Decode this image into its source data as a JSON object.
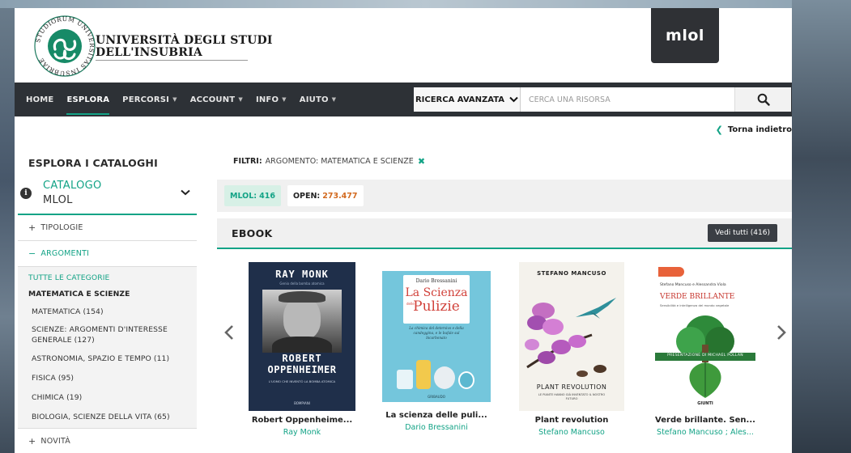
{
  "university": {
    "name_line1": "UNIVERSITÀ DEGLI STUDI",
    "name_line2": "DELL'INSUBRIA",
    "seal_text": "STUDIORUM UNIVERSITAS INSUBRIAE"
  },
  "brand": {
    "logo": "mlol"
  },
  "nav": {
    "items": [
      {
        "label": "HOME",
        "active": false,
        "dropdown": false
      },
      {
        "label": "ESPLORA",
        "active": true,
        "dropdown": false
      },
      {
        "label": "PERCORSI",
        "active": false,
        "dropdown": true
      },
      {
        "label": "ACCOUNT",
        "active": false,
        "dropdown": true
      },
      {
        "label": "INFO",
        "active": false,
        "dropdown": true
      },
      {
        "label": "AIUTO",
        "active": false,
        "dropdown": true
      }
    ]
  },
  "search": {
    "mode_label": "RICERCA AVANZATA",
    "placeholder": "CERCA UNA RISORSA",
    "icon": "search-icon"
  },
  "back_link": "Torna indietro",
  "sidebar": {
    "title": "ESPLORA I CATALOGHI",
    "catalog_label": "CATALOGO",
    "catalog_value": "MLOL",
    "sections": {
      "tipologie": "TIPOLOGIE",
      "argomenti": "ARGOMENTI",
      "novita": "NOVITÀ"
    },
    "categories": {
      "all": "TUTTE LE CATEGORIE",
      "current": "MATEMATICA E SCIENZE",
      "items": [
        "MATEMATICA (154)",
        "SCIENZE: ARGOMENTI D'INTERESSE GENERALE (127)",
        "ASTRONOMIA, SPAZIO E TEMPO (11)",
        "FISICA (95)",
        "CHIMICA (19)",
        "BIOLOGIA, SCIENZE DELLA VITA (65)"
      ]
    }
  },
  "filters": {
    "label": "FILTRI:",
    "value": "ARGOMENTO: MATEMATICA E SCIENZE"
  },
  "tabs": {
    "mlol_label": "MLOL:",
    "mlol_count": "416",
    "open_label": "OPEN:",
    "open_count": "273.477"
  },
  "ebook": {
    "title": "EBOOK",
    "see_all": "Vedi tutti (416)"
  },
  "books": [
    {
      "title": "Robert Oppenheime...",
      "author": "Ray Monk",
      "cover_author": "RAY MONK",
      "cover_sub": "Genio della bomba atomica",
      "cover_title_1": "ROBERT",
      "cover_title_2": "OPPENHEIMER",
      "cover_tag": "L'UOMO CHE INVENTÒ LA BOMBA ATOMICA",
      "cover_publisher": "BOMPIANI"
    },
    {
      "title": "La scienza delle puli...",
      "author": "Dario Bressanini",
      "cover_author": "Dario Bressanini",
      "cover_title_1": "La Scienza",
      "cover_title_small": "delle",
      "cover_title_2": "Pulizie",
      "cover_sub": "La chimica del detersivo e della candeggina, e le bufale sul bicarbonato",
      "cover_publisher": "GRIBAUDO"
    },
    {
      "title": "Plant revolution",
      "author": "Stefano Mancuso",
      "cover_author": "STEFANO MANCUSO",
      "cover_title_1": "PLANT REVOLUTION",
      "cover_sub": "LE PIANTE HANNO GIÀ INVENTATO IL NOSTRO FUTURO"
    },
    {
      "title": "Verde brillante. Sen...",
      "author": "Stefano Mancuso ; Ales...",
      "cover_author": "Stefano Mancuso e Alessandra Viola",
      "cover_title_1": "VERDE BRILLANTE",
      "cover_sub": "Sensibilità e intelligenza del mondo vegetale",
      "cover_banner": "PRESENTAZIONE DI MICHAEL POLLAN",
      "cover_publisher": "GIUNTI"
    }
  ],
  "colors": {
    "accent": "#13a386",
    "nav_bg": "#2d3136",
    "open_count": "#d2691e"
  }
}
